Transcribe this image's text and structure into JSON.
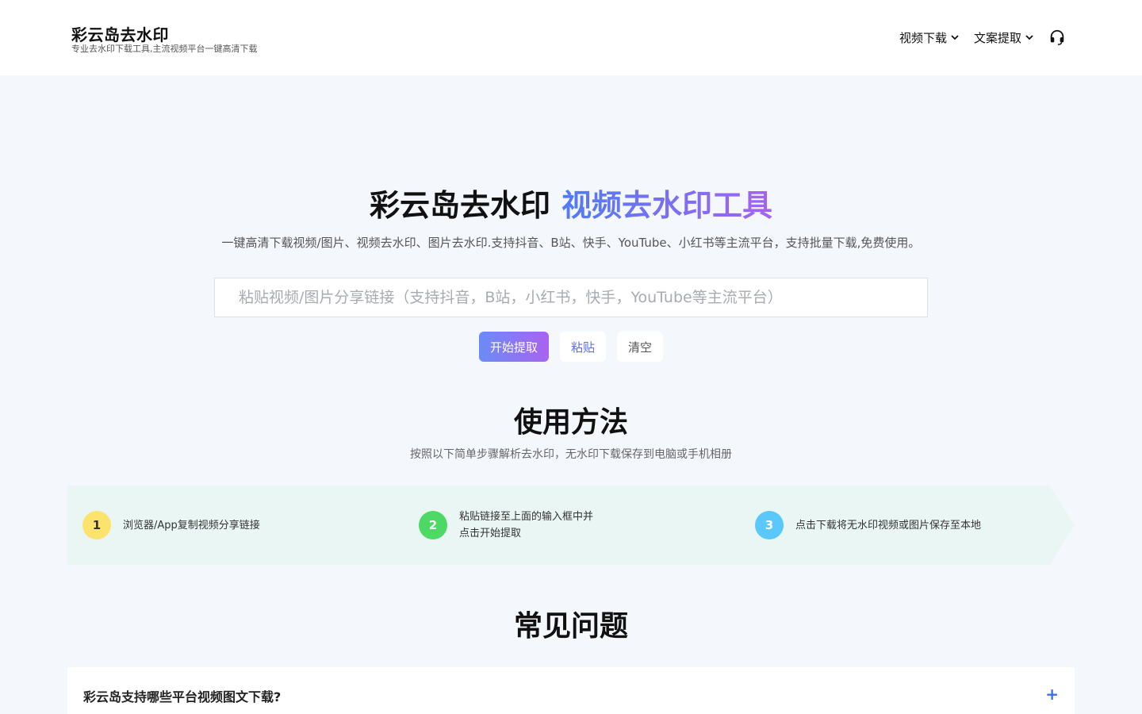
{
  "brand": {
    "title": "彩云岛去水印",
    "subtitle": "专业去水印下载工具,主流视频平台一键高清下载"
  },
  "nav": {
    "items": [
      {
        "label": "视频下载",
        "icon": "chevron-down-icon"
      },
      {
        "label": "文案提取",
        "icon": "chevron-down-icon"
      }
    ],
    "support_icon": "headset-icon"
  },
  "hero": {
    "title_main": "彩云岛去水印",
    "title_accent": "视频去水印工具",
    "description": "一键高清下载视频/图片、视频去水印、图片去水印.支持抖音、B站、快手、YouTube、小红书等主流平台，支持批量下载,免费使用。",
    "accent_colors": [
      "#4f7cf5",
      "#a463f0"
    ]
  },
  "search": {
    "value": "",
    "placeholder": "粘贴视频/图片分享链接（支持抖音，B站，小红书，快手，YouTube等主流平台）"
  },
  "actions": {
    "start_label": "开始提取",
    "paste_label": "粘贴",
    "clear_label": "清空"
  },
  "usage": {
    "title": "使用方法",
    "subtitle": "按照以下简单步骤解析去水印，无水印下载保存到电脑或手机相册",
    "steps": [
      {
        "num": "1",
        "line1": "浏览器/App复制视频分享链接",
        "line2": "",
        "color": "#fbe36d",
        "num_color": "#333333"
      },
      {
        "num": "2",
        "line1": "粘贴链接至上面的输入框中并",
        "line2": "点击开始提取",
        "color": "#4cd964",
        "num_color": "#ffffff"
      },
      {
        "num": "3",
        "line1": "点击下载将无水印视频或图片保存至本地",
        "line2": "",
        "color": "#5ac8fa",
        "num_color": "#ffffff"
      }
    ]
  },
  "faq": {
    "title": "常见问题",
    "items": [
      {
        "question": "彩云岛支持哪些平台视频图文下载?",
        "toggle": "+"
      }
    ]
  }
}
